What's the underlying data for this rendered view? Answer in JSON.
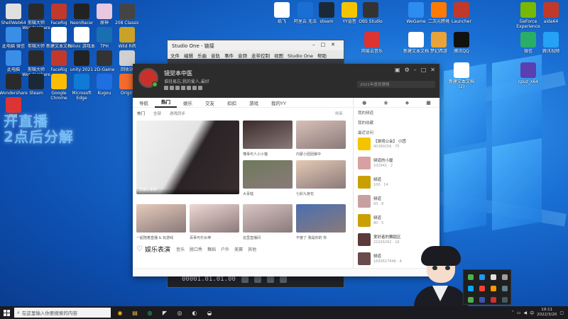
{
  "desktop": {
    "left_icons": [
      {
        "label": "ShellWeb64",
        "color": "#e0e0e0"
      },
      {
        "label": "剪辑大师 Wondershare",
        "color": "#2a2a2a"
      },
      {
        "label": "FaceRig",
        "color": "#c0392b"
      },
      {
        "label": "NeonRacer",
        "color": "#222222"
      },
      {
        "label": "原神",
        "color": "#e8c8e0"
      },
      {
        "label": "208 Classic",
        "color": "#444444"
      },
      {
        "label": "此电脑 微信",
        "color": "#3a8ee6"
      },
      {
        "label": "剪辑大师",
        "color": "#2a2a2a"
      },
      {
        "label": "新建文本文档",
        "color": "#ffffff"
      },
      {
        "label": "tolivic 游戏本",
        "color": "#ffffff"
      },
      {
        "label": "TPH",
        "color": "#1a6fb0"
      },
      {
        "label": "Wild Rift",
        "color": "#c9a227"
      },
      {
        "label": "此电脑",
        "color": "#3a8ee6"
      },
      {
        "label": "剪辑大师 Wondershare",
        "color": "#2a2a2a"
      },
      {
        "label": "FaceRig",
        "color": "#c0392b"
      },
      {
        "label": "unity 2021",
        "color": "#222222"
      },
      {
        "label": "2D-Game",
        "color": "#333333"
      },
      {
        "label": "回收站",
        "color": "#d0d0d0"
      },
      {
        "label": "Wondershare",
        "color": "#2a2a2a"
      },
      {
        "label": "Steam",
        "color": "#1b2838"
      },
      {
        "label": "Google Chrome",
        "color": "#fbbc05"
      },
      {
        "label": "Microsoft Edge",
        "color": "#0f7bd6"
      },
      {
        "label": "Kugou",
        "color": "#1f6fe0"
      },
      {
        "label": "Origin",
        "color": "#f56c2d"
      },
      {
        "label": "网易",
        "color": "#d33"
      }
    ],
    "top_icons": [
      {
        "label": "纸飞",
        "color": "#ffffff"
      },
      {
        "label": "阿里云 无法",
        "color": "#1a6fd4"
      },
      {
        "label": "steam",
        "color": "#1b2838"
      },
      {
        "label": "YY语音",
        "color": "#f5c400"
      },
      {
        "label": "OBS Studio",
        "color": "#333333"
      },
      {
        "label": "网易云音乐",
        "color": "#d33"
      },
      {
        "label": "WeGame",
        "color": "#2d8cf0"
      },
      {
        "label": "二次元跨境",
        "color": "#ff7a00"
      },
      {
        "label": "Launcher",
        "color": "#c0392b"
      },
      {
        "label": "GeForce Experience",
        "color": "#76b900"
      },
      {
        "label": "aida64",
        "color": "#c0392b"
      },
      {
        "label": "新建文本文档",
        "color": "#ffffff"
      },
      {
        "label": "梦幻西游",
        "color": "#e8a33a"
      },
      {
        "label": "腾讯QQ",
        "color": "#111111"
      },
      {
        "label": "微信",
        "color": "#2aae67"
      },
      {
        "label": "腾讯视频",
        "color": "#25a2f5"
      },
      {
        "label": "新建文本文档(2)",
        "color": "#ffffff"
      },
      {
        "label": "cpuz_x64",
        "color": "#5a3fb0"
      }
    ],
    "stream_overlay": [
      "开直播",
      "2点后分解"
    ]
  },
  "studio_one": {
    "title": "Studio One - 链接",
    "menu": [
      "文件",
      "编辑",
      "乐曲",
      "音轨",
      "事件",
      "音频",
      "走带控制",
      "视图",
      "Studio One",
      "帮助"
    ],
    "timecode": "00001.01.01.00"
  },
  "yy": {
    "user_name": "镜觉本中医",
    "signature": "谁轻易忘,我的爱人,最好",
    "search_hint": "2021年度奖牌榜",
    "nav": [
      "导航",
      "热门",
      "娱乐",
      "交友",
      "扣扣",
      "游戏",
      "我的YY"
    ],
    "subnav": [
      "热门",
      "全部",
      "游戏同步"
    ],
    "refresh": "刷新",
    "featured_caption": "华丽小家族",
    "thumbs": [
      {
        "caption": "懂事可人小小猫",
        "color": "#3b2a2a"
      },
      {
        "caption": "内蒙小团团暴中",
        "color": "#d8c0b8"
      },
      {
        "caption": "大青蛙",
        "color": "#6e7a5a"
      },
      {
        "caption": "七彩九宫花",
        "color": "#e5c9b5"
      },
      {
        "caption": "一起陪着直播 & 玩游戏",
        "color": "#e6cbbb"
      },
      {
        "caption": "百事可乐女神",
        "color": "#f0d8d4"
      },
      {
        "caption": "这里直播间",
        "color": "#d9c4c4"
      },
      {
        "caption": "不傻了 我是你的 你",
        "color": "#4a6fb0"
      }
    ],
    "section": {
      "title": "娱乐表演",
      "tags": [
        "音乐",
        "脱口秀",
        "舞蹈",
        "户外",
        "美赛",
        "其他"
      ]
    },
    "side": {
      "rows": [
        "我的频道",
        "我的收藏",
        "最近访问"
      ],
      "channels": [
        {
          "name": "【游戏公会】 小团",
          "meta": "40389256 · 75",
          "color": "#f5c400"
        },
        {
          "name": "频道的小屋",
          "meta": "102941 · 2",
          "color": "#d8a0a0"
        },
        {
          "name": "频道",
          "meta": "100 · 14",
          "color": "#caa000"
        },
        {
          "name": "频道",
          "meta": "93 · 8",
          "color": "#c9a0a0"
        },
        {
          "name": "频道",
          "meta": "80 · 5",
          "color": "#caa000"
        },
        {
          "name": "爱好者的舞蹈区",
          "meta": "21026262 · 16",
          "color": "#5a3a3a"
        },
        {
          "name": "频道",
          "meta": "1693617446 · 4",
          "color": "#6a4a4a"
        }
      ]
    }
  },
  "taskbar": {
    "search_placeholder": "在这里输入你要搜索的内容",
    "time": "19:11",
    "date": "2022/3/20"
  }
}
